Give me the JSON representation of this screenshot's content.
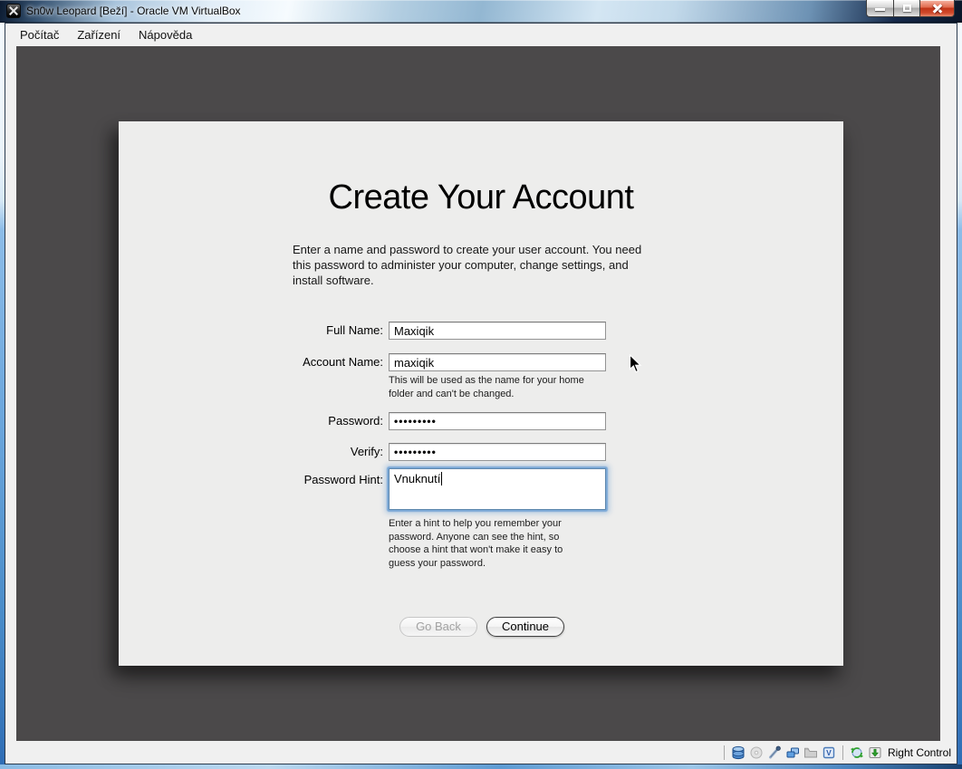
{
  "window": {
    "title": "Sn0w Leopard [Beží] - Oracle VM VirtualBox"
  },
  "menubar": {
    "items": [
      "Počítač",
      "Zařízení",
      "Nápověda"
    ]
  },
  "dialog": {
    "title": "Create Your Account",
    "intro": "Enter a name and password to create your user account. You need\nthis password to administer your computer, change settings, and\ninstall software.",
    "full_name": {
      "label": "Full Name:",
      "value": "Maxiqik"
    },
    "account_name": {
      "label": "Account Name:",
      "value": "maxiqik",
      "help": "This will be used as the name for your home\nfolder and can't be changed."
    },
    "password": {
      "label": "Password:",
      "value": "•••••••••"
    },
    "verify": {
      "label": "Verify:",
      "value": "•••••••••"
    },
    "hint": {
      "label": "Password Hint:",
      "value": "Vnuknutí",
      "help": "Enter a hint to help you remember your\npassword. Anyone can see the hint, so\nchoose a hint that won't make it easy to\nguess your password."
    },
    "buttons": {
      "go_back": "Go Back",
      "continue": "Continue"
    }
  },
  "statusbar": {
    "host_key_label": "Right Control",
    "icons": [
      "hdd-icon",
      "optical-disc-icon",
      "usb-icon",
      "network-icon",
      "shared-folders-icon",
      "virtualization-icon",
      "mouse-integration-icon",
      "keyboard-capture-icon"
    ]
  },
  "colors": {
    "vm_background": "#4b494a",
    "dialog_background": "#ededec",
    "chrome_background": "#f0f0f0",
    "focus_ring": "#78a7d6",
    "close_button_red": "#c13317",
    "frame_blue": "#5d9bd3"
  }
}
